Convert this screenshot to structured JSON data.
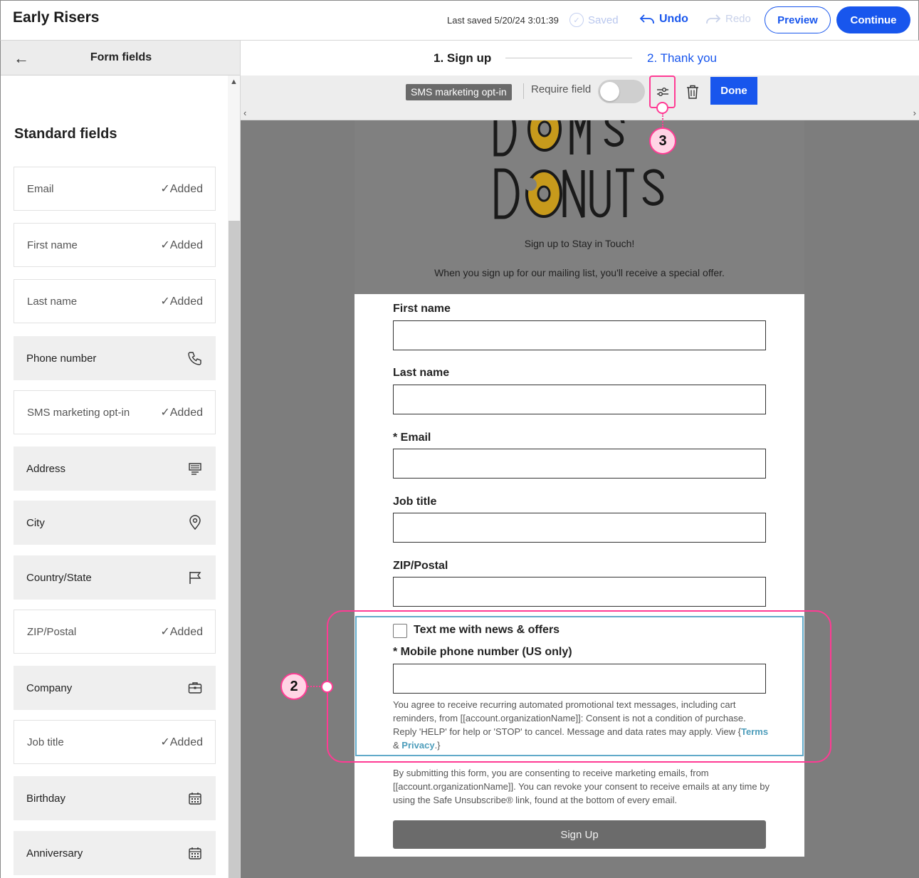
{
  "header": {
    "title": "Early Risers",
    "last_saved": "Last saved 5/20/24 3:01:39",
    "saved_label": "Saved",
    "undo_label": "Undo",
    "redo_label": "Redo",
    "preview_label": "Preview",
    "continue_label": "Continue"
  },
  "sidebar": {
    "title": "Form fields",
    "section_heading": "Standard fields",
    "added_label": "Added",
    "items": [
      {
        "label": "Email",
        "added": true
      },
      {
        "label": "First name",
        "added": true
      },
      {
        "label": "Last name",
        "added": true
      },
      {
        "label": "Phone number",
        "added": false,
        "icon": "phone-icon"
      },
      {
        "label": "SMS marketing opt-in",
        "added": true
      },
      {
        "label": "Address",
        "added": false,
        "icon": "address-icon"
      },
      {
        "label": "City",
        "added": false,
        "icon": "location-pin-icon"
      },
      {
        "label": "Country/State",
        "added": false,
        "icon": "flag-icon"
      },
      {
        "label": "ZIP/Postal",
        "added": true
      },
      {
        "label": "Company",
        "added": false,
        "icon": "briefcase-icon"
      },
      {
        "label": "Job title",
        "added": true
      },
      {
        "label": "Birthday",
        "added": false,
        "icon": "calendar-icon"
      },
      {
        "label": "Anniversary",
        "added": false,
        "icon": "calendar-icon"
      }
    ]
  },
  "steps": {
    "step1": "1.  Sign up",
    "step2": "2.  Thank you"
  },
  "toolbar": {
    "tag": "SMS marketing opt-in",
    "require_label": "Require field",
    "require_on": false,
    "done_label": "Done"
  },
  "form": {
    "subtitle": "Sign up to Stay in Touch!",
    "offer": "When you sign up for our mailing list, you'll receive a special offer.",
    "fields": [
      {
        "label": "First name"
      },
      {
        "label": "Last name"
      },
      {
        "label": "* Email"
      },
      {
        "label": "Job title"
      },
      {
        "label": "ZIP/Postal"
      }
    ],
    "sms_checkbox_label": "Text me with news & offers",
    "mobile_label": "* Mobile phone number (US only)",
    "disclaimer_before": "You agree to receive recurring automated promotional text messages, including cart reminders, from [[account.organizationName]]: Consent is not a condition of purchase. Reply 'HELP' for help or 'STOP' to cancel. Message and data rates may apply. View {",
    "terms_label": "Terms",
    "and_label": " & ",
    "privacy_label": "Privacy",
    "disclaimer_after": ".}",
    "consent": "By submitting this form, you are consenting to receive marketing emails, from [[account.organizationName]]. You can revoke your consent to receive emails at any time by using the Safe Unsubscribe® link, found at the bottom of every email.",
    "signup_label": "Sign Up"
  },
  "callouts": {
    "two": "2",
    "three": "3"
  },
  "colors": {
    "accent": "#1856ed",
    "callout": "#ff3b94",
    "sms_outline": "#61aac9"
  }
}
